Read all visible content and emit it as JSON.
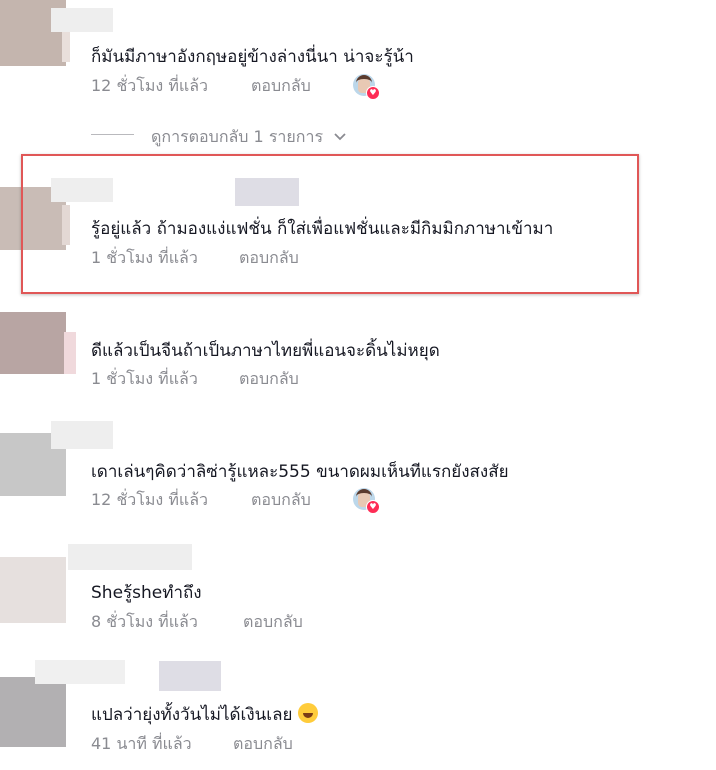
{
  "colors": {
    "meta_grey": "#8a8b91",
    "highlight_border": "#e05757",
    "heart_red": "#fe2c55"
  },
  "comments": [
    {
      "text": "ก็มันมีภาษาอังกฤษอยู่ข้างล่างนี่นา น่าจะรู้น้า",
      "time": "12 ชั่วโมง ที่แล้ว",
      "reply_label": "ตอบกลับ",
      "creator_liked": true
    },
    {
      "text": "รู้อยู่แล้ว ถ้ามองแง่แฟชั่น ก็ใส่เพื่อแฟชั่นและมีกิมมิกภาษาเข้ามา",
      "time": "1 ชั่วโมง ที่แล้ว",
      "reply_label": "ตอบกลับ",
      "creator_liked": false,
      "highlighted": true
    },
    {
      "text": "ดีแล้วเป็นจีนถ้าเป็นภาษาไทยพี่แอนจะดิ้นไม่หยุด",
      "time": "1 ชั่วโมง ที่แล้ว",
      "reply_label": "ตอบกลับ",
      "creator_liked": false
    },
    {
      "text": "เดาเล่นๆคิดว่าลิซ่ารู้แหละ555 ขนาดผมเห็นทีแรกยังสงสัย",
      "time": "12 ชั่วโมง ที่แล้ว",
      "reply_label": "ตอบกลับ",
      "creator_liked": true
    },
    {
      "text": "Sheรู้sheทำถึง",
      "time": "8 ชั่วโมง ที่แล้ว",
      "reply_label": "ตอบกลับ",
      "creator_liked": false
    },
    {
      "text": "แปลว่ายุ่งทั้งวันไม่ได้เงินเลย",
      "time": "41 นาที ที่แล้ว",
      "reply_label": "ตอบกลับ",
      "creator_liked": false,
      "emoji": "grinning-sweat-emoji"
    }
  ],
  "view_replies": {
    "label": "ดูการตอบกลับ 1 รายการ",
    "icon": "chevron-down-icon"
  }
}
